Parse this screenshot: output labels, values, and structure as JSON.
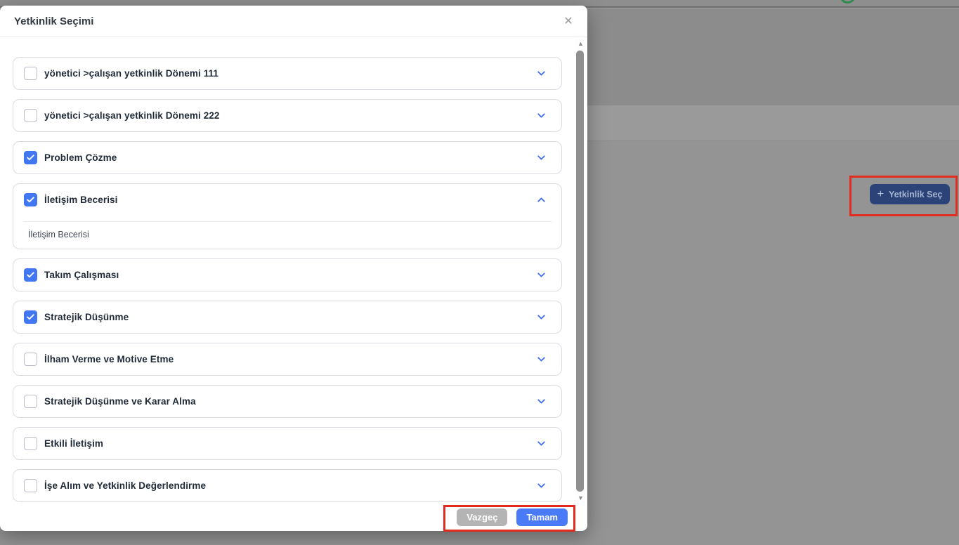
{
  "modal": {
    "title": "Yetkinlik Seçimi",
    "close_icon": "✕",
    "items": [
      {
        "label": "yönetici >çalışan yetkinlik Dönemi 111",
        "checked": false,
        "expanded": false
      },
      {
        "label": "yönetici >çalışan yetkinlik Dönemi 222",
        "checked": false,
        "expanded": false
      },
      {
        "label": "Problem Çözme",
        "checked": true,
        "expanded": false
      },
      {
        "label": "İletişim Becerisi",
        "checked": true,
        "expanded": true,
        "children": [
          "İletişim Becerisi"
        ]
      },
      {
        "label": "Takım Çalışması",
        "checked": true,
        "expanded": false
      },
      {
        "label": "Stratejik Düşünme",
        "checked": true,
        "expanded": false
      },
      {
        "label": "İlham Verme ve Motive Etme",
        "checked": false,
        "expanded": false
      },
      {
        "label": "Stratejik Düşünme ve Karar Alma",
        "checked": false,
        "expanded": false
      },
      {
        "label": "Etkili İletişim",
        "checked": false,
        "expanded": false
      },
      {
        "label": "İşe Alım ve Yetkinlik Değerlendirme",
        "checked": false,
        "expanded": false
      }
    ],
    "scrollbar": {
      "up_icon": "▲",
      "down_icon": "▼"
    },
    "footer": {
      "cancel_label": "Vazgeç",
      "ok_label": "Tamam"
    }
  },
  "background": {
    "select_button": {
      "plus_icon": "+",
      "label": "Yetkinlik Seç"
    }
  },
  "colors": {
    "checkbox_checked": "#4178f2",
    "chevron": "#3d6ef5",
    "ok_button": "#4a7bf6",
    "cancel_button": "#b4b4b4",
    "annotation_red": "#e12b1f",
    "background_select_button": "#2c4377",
    "avatar_ring_green": "#2e8b4f"
  }
}
